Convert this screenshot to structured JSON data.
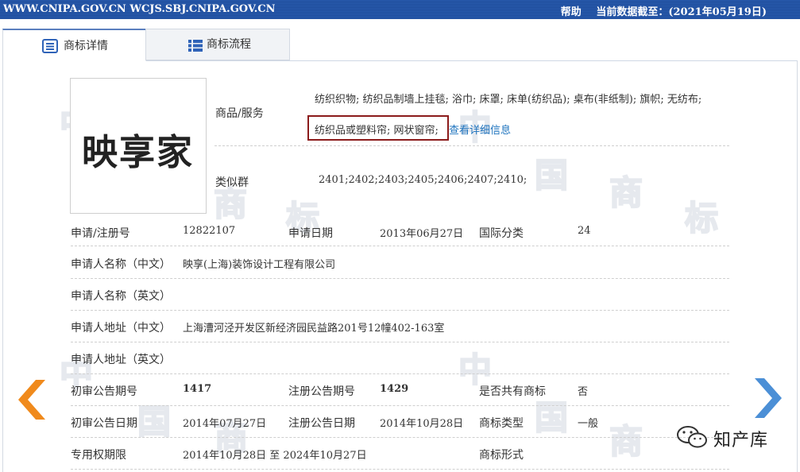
{
  "topbar": {
    "urls": "WWW.CNIPA.GOV.CN WCJS.SBJ.CNIPA.GOV.CN",
    "help": "帮助",
    "data_date": "当前数据截至：(2021年05月19日)"
  },
  "tabs": [
    {
      "label": "商标详情",
      "icon": "list-detail-icon",
      "active": true
    },
    {
      "label": "商标流程",
      "icon": "list-flow-icon",
      "active": false
    }
  ],
  "watermark": {
    "chars": [
      "中",
      "国",
      "商",
      "标"
    ]
  },
  "logo": {
    "text": "映享家"
  },
  "goods": {
    "label": "商品/服务",
    "line1": "纺织织物; 纺织品制墙上挂毯; 浴巾; 床罩; 床单(纺织品); 桌布(非纸制); 旗帜; 无纺布;",
    "line2_highlight": "纺织品或塑料帘; 网状窗帘;",
    "detail_link": "查看详细信息"
  },
  "similar_group": {
    "label": "类似群",
    "value": "2401;2402;2403;2405;2406;2407;2410;"
  },
  "rows": {
    "reg_no_label": "申请/注册号",
    "reg_no": "12822107",
    "app_date_label": "申请日期",
    "app_date": "2013年06月27日",
    "intl_class_label": "国际分类",
    "intl_class": "24",
    "applicant_cn_label": "申请人名称（中文）",
    "applicant_cn": "映享(上海)装饰设计工程有限公司",
    "applicant_en_label": "申请人名称（英文）",
    "address_cn_label": "申请人地址（中文）",
    "address_cn": "上海漕河泾开发区新经济园民益路201号12幢402-163室",
    "address_en_label": "申请人地址（英文）",
    "prelim_no_label": "初审公告期号",
    "prelim_no": "1417",
    "reg_pub_no_label": "注册公告期号",
    "reg_pub_no": "1429",
    "shared_label": "是否共有商标",
    "shared": "否",
    "prelim_date_label": "初审公告日期",
    "prelim_date": "2014年07月27日",
    "reg_pub_date_label": "注册公告日期",
    "reg_pub_date": "2014年10月28日",
    "type_label": "商标类型",
    "type": "一般",
    "term_label": "专用权期限",
    "term": "2014年10月28日 至 2024年10月27日",
    "form_label": "商标形式"
  },
  "nav": {
    "prev_icon": "chevron-left-icon",
    "next_icon": "chevron-right-icon"
  },
  "wechat": {
    "icon": "wechat-icon",
    "label": "知产库"
  },
  "colors": {
    "topbar": "#1f4fa0",
    "arrow_left": "#f08a1c",
    "arrow_right": "#4b8fd6",
    "highlight_border": "#8b1b1b",
    "link": "#1e73be"
  }
}
